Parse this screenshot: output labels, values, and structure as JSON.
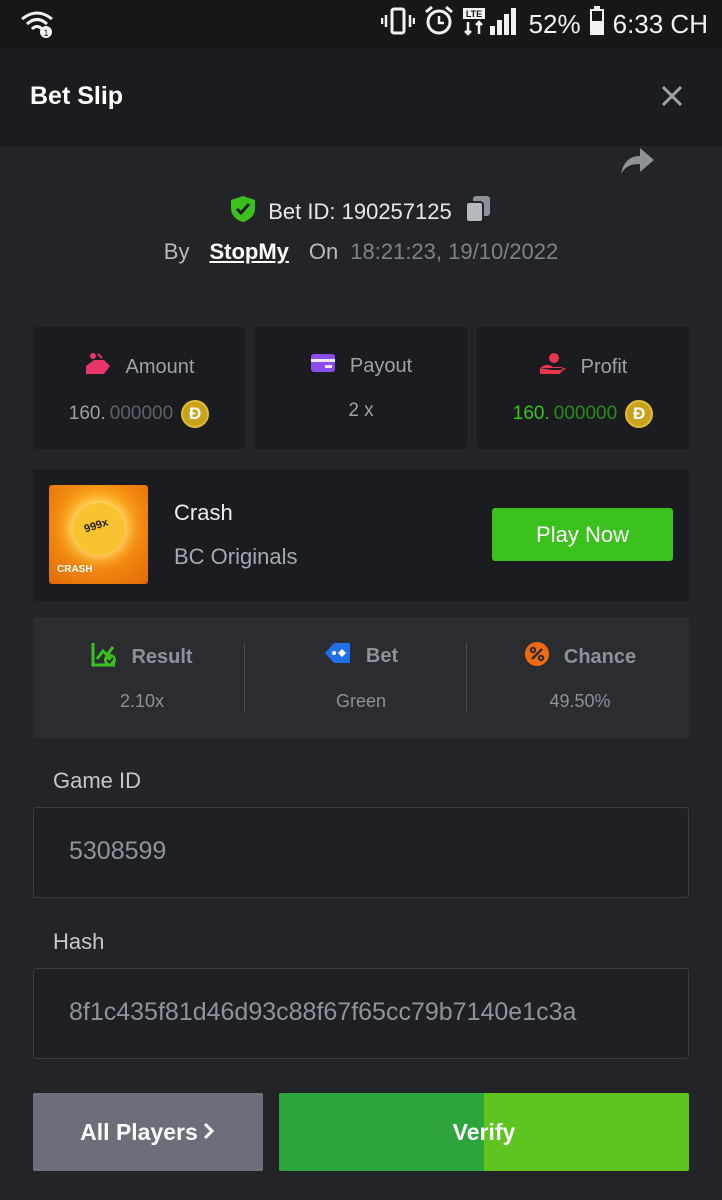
{
  "status_bar": {
    "battery": "52%",
    "time": "6:33 CH",
    "network": "LTE"
  },
  "header": {
    "title": "Bet Slip"
  },
  "bet": {
    "id_label": "Bet ID: 190257125",
    "by_label": "By",
    "user": "StopMy",
    "on_label": "On",
    "datetime": "18:21:23, 19/10/2022"
  },
  "stats": [
    {
      "label": "Amount",
      "value_main": "160.",
      "value_dim": "000000",
      "coin": true,
      "color": "#9ea2aa"
    },
    {
      "label": "Payout",
      "value_main": "2 x",
      "value_dim": "",
      "coin": false,
      "color": "#9ea2aa"
    },
    {
      "label": "Profit",
      "value_main": "160.",
      "value_dim": "000000",
      "coin": true,
      "color": "#3bc11e"
    }
  ],
  "coin_symbol": "Ð",
  "game": {
    "name": "Crash",
    "provider": "BC Originals",
    "thumb_multiplier": "999x",
    "thumb_tag": "CRASH",
    "play_label": "Play Now"
  },
  "result": [
    {
      "label": "Result",
      "value": "2.10x"
    },
    {
      "label": "Bet",
      "value": "Green"
    },
    {
      "label": "Chance",
      "value": "49.50%"
    }
  ],
  "fields": {
    "game_id_label": "Game ID",
    "game_id_value": "5308599",
    "hash_label": "Hash",
    "hash_value": "8f1c435f81d46d93c88f67f65cc79b7140e1c3a"
  },
  "buttons": {
    "all_players": "All Players",
    "verify": "Verify"
  },
  "colors": {
    "accent_green": "#3bc11e",
    "background": "#232427",
    "card": "#1b1c1f"
  }
}
